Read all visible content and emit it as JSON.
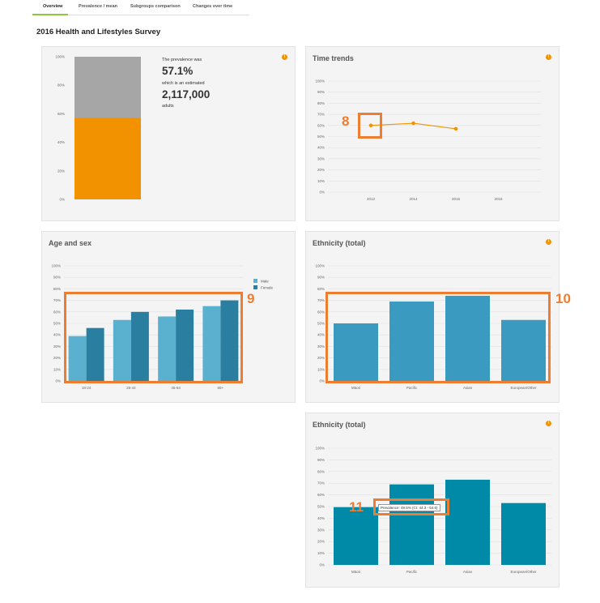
{
  "tabs": [
    "Overview",
    "Prevalence / mean",
    "Subgroups comparison",
    "Changes over time"
  ],
  "page_title": "2016 Health and Lifestyles Survey",
  "info_icon": "i",
  "colors": {
    "orange": "#f39200",
    "grey_bar": "#a6a6a6",
    "male": "#5ab1cf",
    "female": "#2a7fa0",
    "ethnicity": "#3a9ac0",
    "ethnicity_dark": "#008aa8",
    "annotation": "#ed7d31"
  },
  "prevalence": {
    "line1": "The prevalence was",
    "value": "57.1%",
    "line2": "which is an estimated",
    "count": "2,117,000",
    "line3": "adults"
  },
  "annotations": {
    "a8": "8",
    "a9": "9",
    "a10": "10",
    "a11": "11"
  },
  "tooltip": "Prevalence: 49.5% (CI: 44.3 - 54.6)",
  "chart_data": [
    {
      "type": "bar",
      "title": "",
      "categories": [
        ""
      ],
      "values": [
        57.1
      ],
      "ylim": [
        0,
        100
      ],
      "yticks": [
        "100%",
        "80%",
        "60%",
        "40%",
        "20%",
        "0%"
      ]
    },
    {
      "type": "line",
      "title": "Time trends",
      "x": [
        "2012",
        "2014",
        "2016",
        "2018"
      ],
      "values": [
        60,
        62,
        57,
        null
      ],
      "ylim": [
        0,
        100
      ],
      "yticks": [
        "100%",
        "90%",
        "80%",
        "70%",
        "60%",
        "50%",
        "40%",
        "30%",
        "20%",
        "10%",
        "0%"
      ]
    },
    {
      "type": "bar",
      "title": "Age and sex",
      "categories": [
        "18-24",
        "25-44",
        "45-64",
        "65+"
      ],
      "series": [
        {
          "name": "Male",
          "values": [
            39,
            53,
            56,
            65
          ]
        },
        {
          "name": "Female",
          "values": [
            46,
            60,
            62,
            70
          ]
        }
      ],
      "ylim": [
        0,
        100
      ],
      "legend": "top-right",
      "yticks": [
        "100%",
        "90%",
        "80%",
        "70%",
        "60%",
        "50%",
        "40%",
        "30%",
        "20%",
        "10%",
        "0%"
      ]
    },
    {
      "type": "bar",
      "title": "Ethnicity (total)",
      "categories": [
        "Māori",
        "Pacific",
        "Asian",
        "European/Other"
      ],
      "values": [
        50,
        69,
        74,
        53
      ],
      "ylim": [
        0,
        100
      ],
      "yticks": [
        "100%",
        "90%",
        "80%",
        "70%",
        "60%",
        "50%",
        "40%",
        "30%",
        "20%",
        "10%",
        "0%"
      ]
    },
    {
      "type": "bar",
      "title": "Ethnicity (total)",
      "categories": [
        "Māori",
        "Pacific",
        "Asian",
        "European/Other"
      ],
      "values": [
        49.5,
        69,
        73,
        53
      ],
      "ylim": [
        0,
        100
      ],
      "yticks": [
        "100%",
        "90%",
        "80%",
        "70%",
        "60%",
        "50%",
        "40%",
        "30%",
        "20%",
        "10%",
        "0%"
      ]
    }
  ]
}
